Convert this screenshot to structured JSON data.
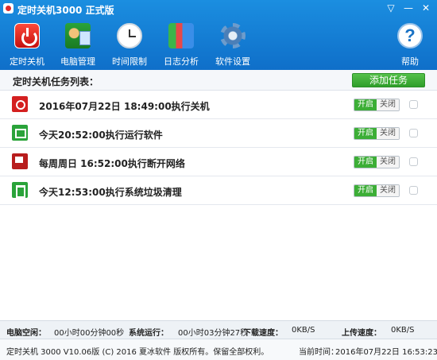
{
  "window": {
    "title": "定时关机3000 正式版",
    "controls": [
      "▽",
      "—",
      "✕"
    ]
  },
  "toolbar": [
    {
      "label": "定时关机",
      "icon": "power-icon"
    },
    {
      "label": "电脑管理",
      "icon": "computer-manage-icon"
    },
    {
      "label": "时间限制",
      "icon": "clock-icon"
    },
    {
      "label": "日志分析",
      "icon": "log-chart-icon"
    },
    {
      "label": "软件设置",
      "icon": "gear-icon"
    },
    {
      "label": "帮助",
      "icon": "help-icon"
    }
  ],
  "list": {
    "title": "定时关机任务列表：",
    "add_button": "添加任务",
    "tasks": [
      {
        "text": "2016年07月22日 18:49:00执行关机",
        "icon": "shutdown-icon",
        "on": "开启",
        "off": "关闭"
      },
      {
        "text": "今天20:52:00执行运行软件",
        "icon": "run-program-icon",
        "on": "开启",
        "off": "关闭"
      },
      {
        "text": "每周周日 16:52:00执行断开网络",
        "icon": "disconnect-network-icon",
        "on": "开启",
        "off": "关闭"
      },
      {
        "text": "今天12:53:00执行系统垃圾清理",
        "icon": "trash-clean-icon",
        "on": "开启",
        "off": "关闭"
      }
    ]
  },
  "status": {
    "idle_label": "电脑空闲：",
    "idle_value": "00小时00分钟00秒",
    "uptime_label": "系统运行：",
    "uptime_value": "00小时03分钟27秒",
    "download_label": "下载速度：",
    "download_value": "0KB/S",
    "upload_label": "上传速度：",
    "upload_value": "0KB/S"
  },
  "footer": {
    "copyright": "定时关机 3000 V10.06版 (C) 2016  夏冰软件 版权所有。保留全部权利。",
    "time_label": "当前时间：",
    "time_value": "2016年07月22日 16:53:23"
  },
  "colors": {
    "header": "#1580d8",
    "accent_green": "#3cae36"
  }
}
